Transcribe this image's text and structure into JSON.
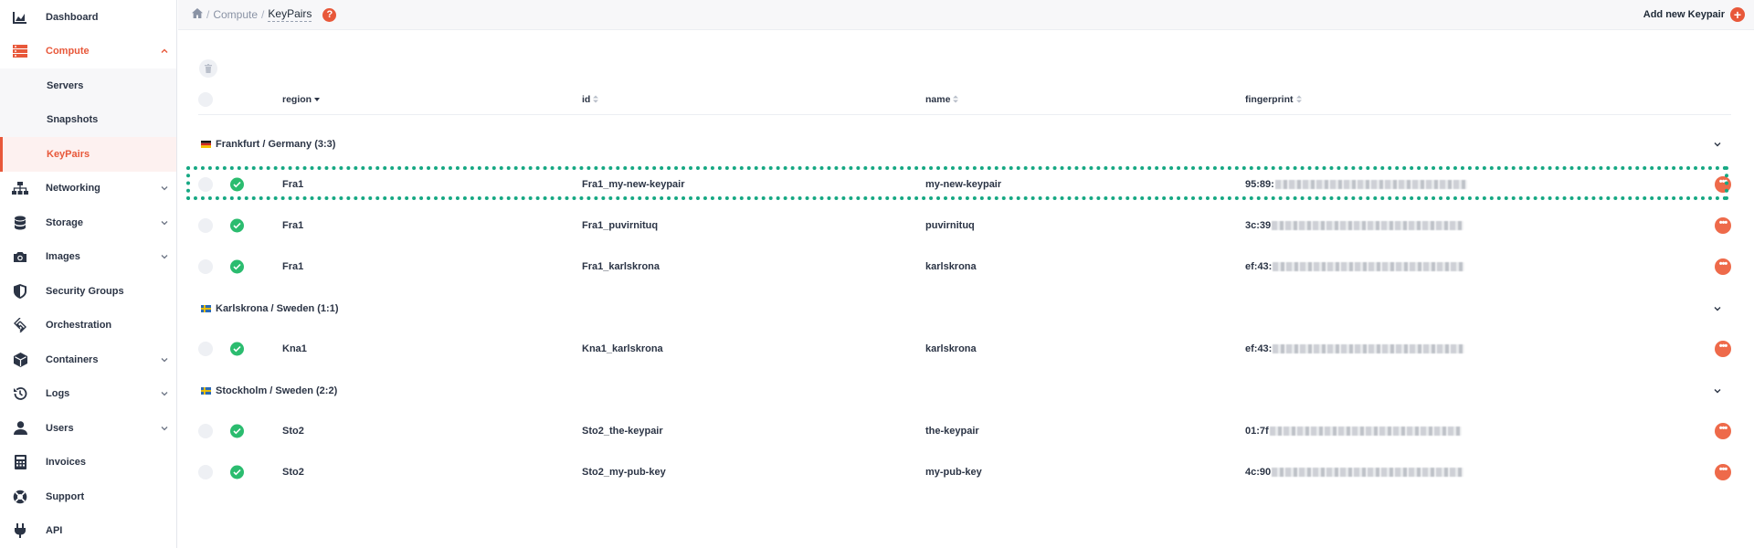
{
  "sidebar": {
    "items": [
      {
        "label": "Dashboard",
        "icon": "chart-icon"
      },
      {
        "label": "Compute",
        "icon": "server-stack-icon",
        "active": true,
        "expanded": true,
        "children": [
          {
            "label": "Servers"
          },
          {
            "label": "Snapshots"
          },
          {
            "label": "KeyPairs",
            "selected": true
          }
        ]
      },
      {
        "label": "Networking",
        "icon": "network-icon",
        "has_children": true
      },
      {
        "label": "Storage",
        "icon": "database-icon",
        "has_children": true
      },
      {
        "label": "Images",
        "icon": "camera-icon",
        "has_children": true
      },
      {
        "label": "Security Groups",
        "icon": "shield-icon"
      },
      {
        "label": "Orchestration",
        "icon": "orchestration-icon"
      },
      {
        "label": "Containers",
        "icon": "cube-icon",
        "has_children": true
      },
      {
        "label": "Logs",
        "icon": "history-icon",
        "has_children": true
      },
      {
        "label": "Users",
        "icon": "user-icon",
        "has_children": true
      },
      {
        "label": "Invoices",
        "icon": "calculator-icon"
      },
      {
        "label": "Support",
        "icon": "lifebuoy-icon"
      },
      {
        "label": "API",
        "icon": "plug-icon"
      }
    ]
  },
  "breadcrumb": {
    "home_icon": "home-icon",
    "section": "Compute",
    "current": "KeyPairs",
    "sep": "/",
    "help": "?"
  },
  "header": {
    "add_label": "Add new Keypair",
    "add_icon": "+"
  },
  "table": {
    "columns": [
      {
        "label": "region",
        "sort": "desc"
      },
      {
        "label": "id",
        "sort": "none"
      },
      {
        "label": "name",
        "sort": "none"
      },
      {
        "label": "fingerprint",
        "sort": "none"
      }
    ],
    "groups": [
      {
        "label": "Frankfurt / Germany (3:3)",
        "flag": "de",
        "rows": [
          {
            "region": "Fra1",
            "id": "Fra1_my-new-keypair",
            "name": "my-new-keypair",
            "fingerprint": "95:89:"
          },
          {
            "region": "Fra1",
            "id": "Fra1_puvirnituq",
            "name": "puvirnituq",
            "fingerprint": "3c:39"
          },
          {
            "region": "Fra1",
            "id": "Fra1_karlskrona",
            "name": "karlskrona",
            "fingerprint": "ef:43:"
          }
        ]
      },
      {
        "label": "Karlskrona / Sweden (1:1)",
        "flag": "se",
        "rows": [
          {
            "region": "Kna1",
            "id": "Kna1_karlskrona",
            "name": "karlskrona",
            "fingerprint": "ef:43:"
          }
        ]
      },
      {
        "label": "Stockholm / Sweden (2:2)",
        "flag": "se",
        "rows": [
          {
            "region": "Sto2",
            "id": "Sto2_the-keypair",
            "name": "the-keypair",
            "fingerprint": "01:7f"
          },
          {
            "region": "Sto2",
            "id": "Sto2_my-pub-key",
            "name": "my-pub-key",
            "fingerprint": "4c:90"
          }
        ]
      }
    ]
  },
  "colors": {
    "accent": "#e8583a",
    "success": "#2bbc6f",
    "highlight": "#16a883"
  }
}
